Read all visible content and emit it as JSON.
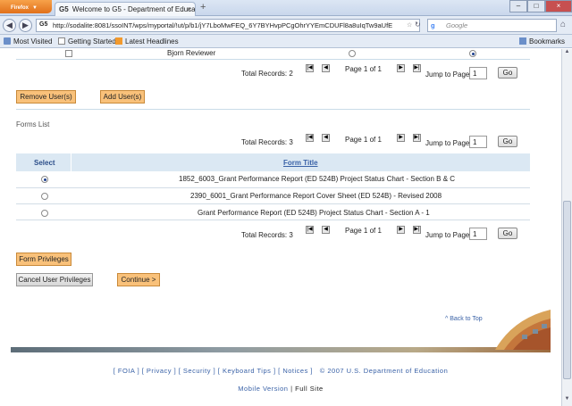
{
  "browser": {
    "app_button": "Firefox",
    "tab_title": "Welcome to G5 - Department of Educatio...",
    "tab_favicon": "G5",
    "url": "http://sodalite:8081/ssoINT/wps/myportal/!ut/p/b1/jY7LboMwFEQ_6Y7BYHvpPCgOhrYYEmCDUFl8a8uIqTw9aUfE",
    "search_placeholder": "Google",
    "bookmarks": [
      "Most Visited",
      "Getting Started",
      "Latest Headlines"
    ],
    "bookmarks_menu": "Bookmarks"
  },
  "users_section": {
    "row_name": "Bjorn Reviewer",
    "total_records": "Total Records: 2",
    "page_info": "Page 1 of 1",
    "jump_label": "Jump to Page",
    "jump_value": "1",
    "go_label": "Go",
    "remove_button": "Remove User(s)",
    "add_button": "Add User(s)"
  },
  "forms_section": {
    "heading": "Forms List",
    "total_records": "Total Records: 3",
    "page_info": "Page 1 of 1",
    "jump_label": "Jump to Page",
    "jump_value": "1",
    "go_label": "Go",
    "columns": [
      "Select",
      "Form Title"
    ],
    "rows": [
      {
        "title": "1852_6003_Grant Performance Report (ED 524B) Project Status Chart - Section B & C",
        "selected": true
      },
      {
        "title": "2390_6001_Grant Performance Report Cover Sheet (ED 524B) - Revised 2008",
        "selected": false
      },
      {
        "title": "Grant Performance Report (ED 524B) Project Status Chart - Section A - 1",
        "selected": false
      }
    ],
    "bottom_total_records": "Total Records: 3",
    "bottom_page_info": "Page 1 of 1",
    "bottom_jump_label": "Jump to Page",
    "bottom_jump_value": "1",
    "bottom_go_label": "Go",
    "privileges_button": "Form Privileges"
  },
  "actions": {
    "cancel_button": "Cancel User Privileges",
    "continue_button": "Continue >",
    "back_to_top": "^ Back to Top"
  },
  "footer": {
    "links": [
      "FOIA",
      "Privacy",
      "Security",
      "Keyboard Tips",
      "Notices"
    ],
    "copyright": "© 2007 U.S. Department of Education",
    "mobile": "Mobile Version",
    "separator": "|",
    "full": "Full Site"
  }
}
